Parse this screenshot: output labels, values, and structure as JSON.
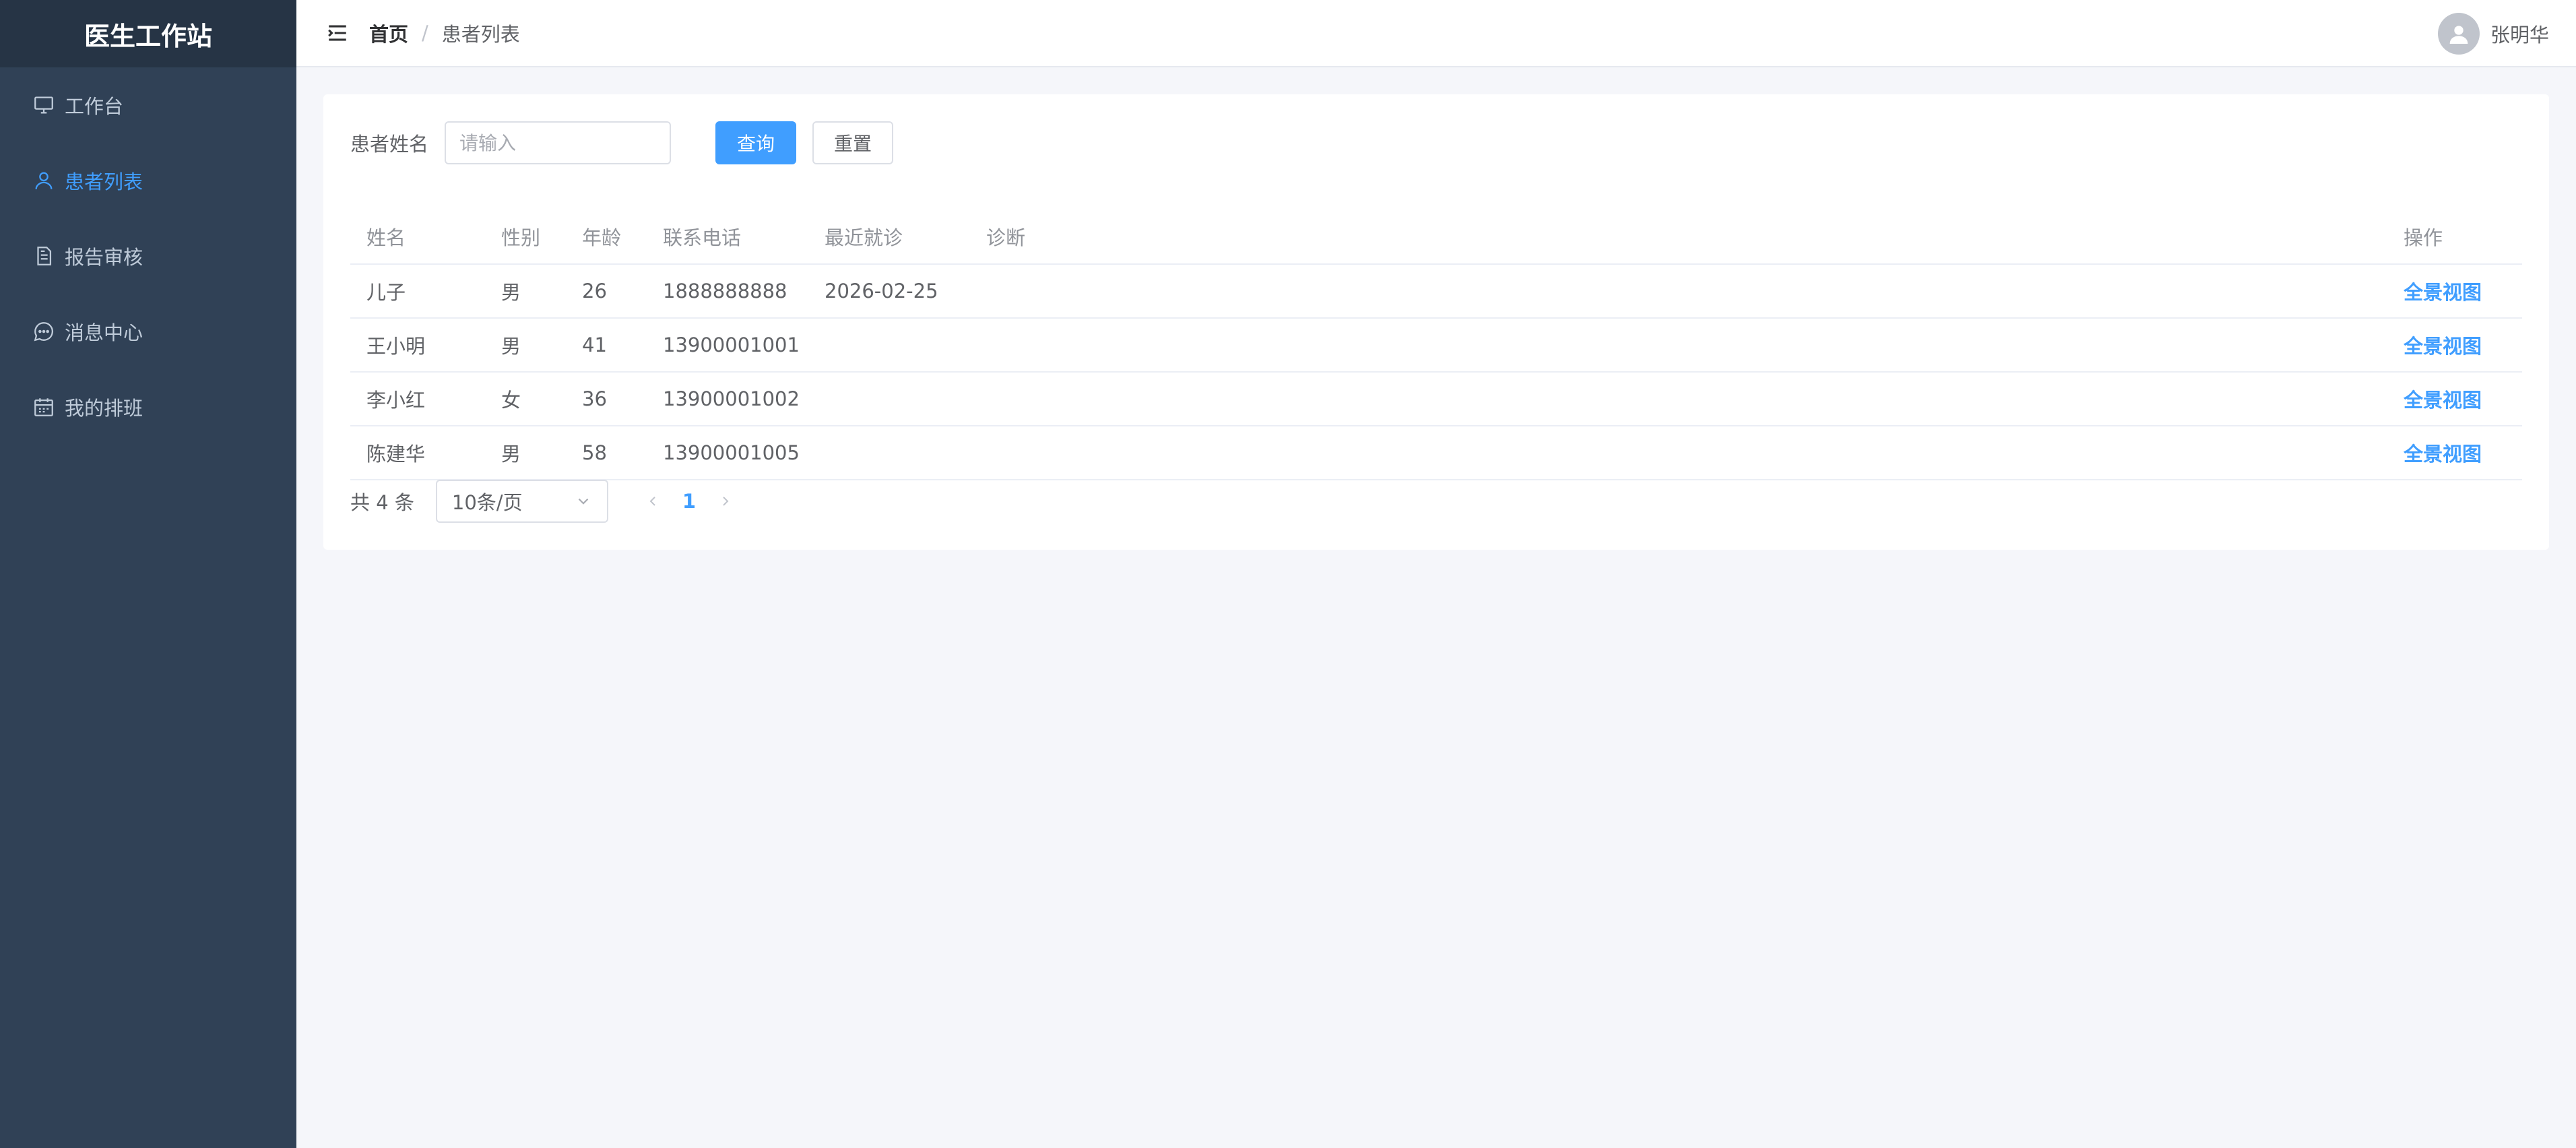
{
  "app": {
    "title": "医生工作站"
  },
  "sidebar": {
    "items": [
      {
        "label": "工作台",
        "icon": "monitor-icon",
        "active": false
      },
      {
        "label": "患者列表",
        "icon": "user-icon",
        "active": true
      },
      {
        "label": "报告审核",
        "icon": "document-icon",
        "active": false
      },
      {
        "label": "消息中心",
        "icon": "chat-icon",
        "active": false
      },
      {
        "label": "我的排班",
        "icon": "calendar-icon",
        "active": false
      }
    ]
  },
  "header": {
    "breadcrumb": {
      "home": "首页",
      "separator": "/",
      "current": "患者列表"
    },
    "user": {
      "name": "张明华"
    }
  },
  "search": {
    "label": "患者姓名",
    "placeholder": "请输入",
    "value": "",
    "query_label": "查询",
    "reset_label": "重置"
  },
  "table": {
    "columns": [
      "姓名",
      "性别",
      "年龄",
      "联系电话",
      "最近就诊",
      "诊断",
      "操作"
    ],
    "rows": [
      {
        "name": "儿子",
        "sex": "男",
        "age": "26",
        "phone": "1888888888",
        "last_visit": "2026-02-25",
        "diagnosis": "",
        "action": "全景视图"
      },
      {
        "name": "王小明",
        "sex": "男",
        "age": "41",
        "phone": "13900001001",
        "last_visit": "",
        "diagnosis": "",
        "action": "全景视图"
      },
      {
        "name": "李小红",
        "sex": "女",
        "age": "36",
        "phone": "13900001002",
        "last_visit": "",
        "diagnosis": "",
        "action": "全景视图"
      },
      {
        "name": "陈建华",
        "sex": "男",
        "age": "58",
        "phone": "13900001005",
        "last_visit": "",
        "diagnosis": "",
        "action": "全景视图"
      }
    ]
  },
  "pagination": {
    "total_text": "共 4 条",
    "page_size": "10条/页",
    "current_page": "1"
  },
  "colors": {
    "sidebar_bg": "#304156",
    "logo_bg": "#263445",
    "accent": "#409eff",
    "page_bg": "#f5f6fa"
  }
}
